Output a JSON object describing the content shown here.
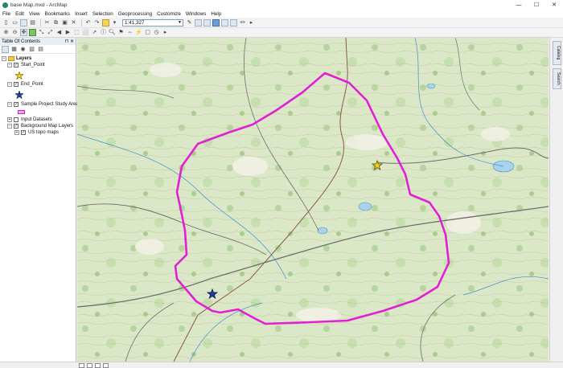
{
  "window": {
    "title": "base Map.mxd - ArcMap",
    "controls": {
      "minimize": "—",
      "maximize": "☐",
      "close": "✕"
    }
  },
  "menu": {
    "items": [
      "File",
      "Edit",
      "View",
      "Bookmarks",
      "Insert",
      "Selection",
      "Geoprocessing",
      "Customize",
      "Windows",
      "Help"
    ]
  },
  "toolbar": {
    "scale_value": "1:41,327"
  },
  "toc": {
    "title": "Table Of Contents",
    "pin": "⊓",
    "close": "✕",
    "layers_group": "Layers",
    "start_point": "Start_Point",
    "end_point": "End_Point",
    "study_area": "Sample Project Study Area",
    "input_datasets": "Input Datasets",
    "background": "Background Map Layers",
    "us_topo": "US topo maps"
  },
  "right_dock": {
    "tab_catalog": "Catalog",
    "tab_search": "Search"
  },
  "colors": {
    "study_area_outline": "#e21fd4",
    "start_symbol": "#f1d21a",
    "end_symbol": "#1f3f9e"
  }
}
